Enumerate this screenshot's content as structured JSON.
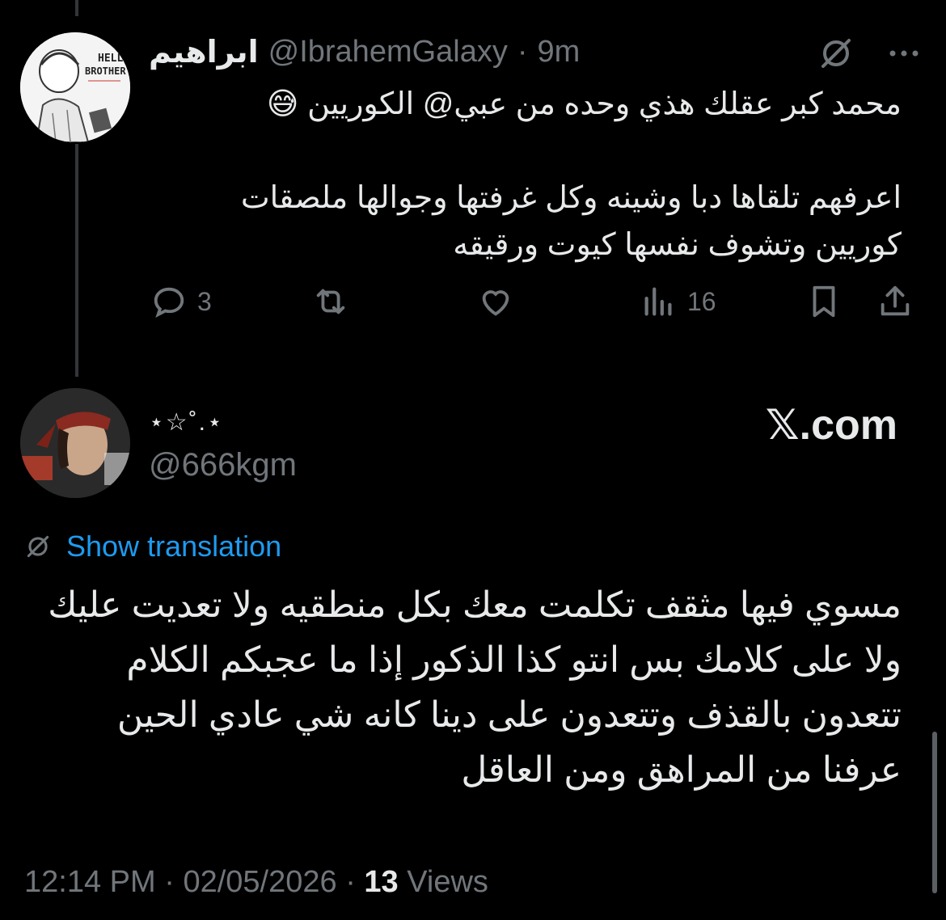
{
  "tweet1": {
    "display_name": "ابراهيم",
    "handle": "@IbrahemGalaxy",
    "separator": "·",
    "time": "9m",
    "avatar_text": "HELLO BROTHER",
    "icons": [
      "grok-icon",
      "more-icon"
    ],
    "text_line1": "محمد كبر عقلك هذي وحده من عبي@ الكوريين 😅",
    "text_para2": "اعرفهم تلقاها دبا وشينه وكل غرفتها وجوالها ملصقات كوريين وتشوف نفسها كيوت ورقيقه",
    "replies": "3",
    "views": "16"
  },
  "tweet2": {
    "display_name": "⋆☆˚.⋆",
    "handle": "@666kgm",
    "brand": "𝕏.com",
    "show_translation": "Show translation",
    "text": "مسوي فيها مثقف تكلمت معك بكل منطقيه ولا تعديت عليك ولا على كلامك بس  انتو كذا الذكور إذا ما عجبكم الكلام تتعدون بالقذف وتتعدون على دينا كانه شي عادي الحين عرفنا من المراهق ومن العاقل",
    "time": "12:14 PM",
    "separator": "·",
    "date": "02/05/2026",
    "views_count": "13",
    "views_label": "Views"
  }
}
